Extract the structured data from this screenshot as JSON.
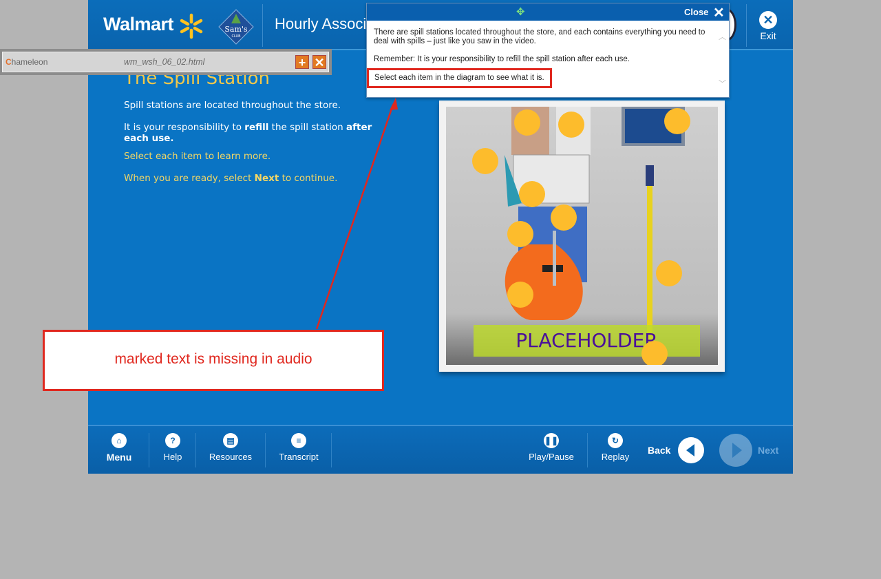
{
  "header": {
    "brand": "Walmart",
    "course_title": "Hourly Associate",
    "exit_label": "Exit"
  },
  "chameleon": {
    "logo_text": "hameleon",
    "logo_initial": "C",
    "filename": "wm_wsh_06_02.html"
  },
  "content": {
    "title": "The Spill Station",
    "para1": "Spill stations are located throughout the store.",
    "para2_pre": "It is your responsibility to ",
    "para2_b1": "refill",
    "para2_mid": " the spill station ",
    "para2_b2": "after each use.",
    "para3": "Select each item to learn more.",
    "para4_pre": "When you are ready, select ",
    "para4_b": "Next",
    "para4_post": " to continue."
  },
  "diagram": {
    "placeholder": "PLACEHOLDER",
    "hotspot_count": 11
  },
  "popup": {
    "close_label": "Close",
    "text1": "There are spill stations located throughout the store, and each contains everything you need to deal with spills – just like you saw in the video.",
    "text2": "Remember:  It is your responsibility to refill the spill station after each use.",
    "text3": "Select each item in the diagram to see what it is."
  },
  "annotation": {
    "text": "marked text is missing in audio",
    "color": "#e0281f"
  },
  "footer": {
    "menu": "Menu",
    "help": "Help",
    "resources": "Resources",
    "transcript": "Transcript",
    "play_pause": "Play/Pause",
    "replay": "Replay",
    "back": "Back",
    "next": "Next"
  },
  "colors": {
    "app_blue": "#0a74c4",
    "accent_yellow": "#f3c84a",
    "hotspot": "#fdbc2c"
  }
}
